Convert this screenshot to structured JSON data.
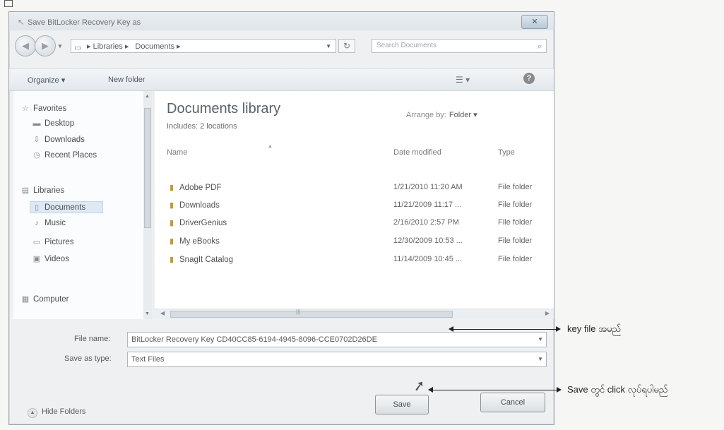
{
  "window": {
    "title": "Save BitLocker Recovery Key as",
    "close_label": "✕"
  },
  "address": {
    "back": "◀",
    "forward": "▶",
    "crumbs": [
      "▸ Libraries ▸",
      "Documents ▸"
    ],
    "search_placeholder": "Search Documents"
  },
  "toolbar": {
    "organize": "Organize ▾",
    "new_folder": "New folder",
    "views": "☰ ▾",
    "help": "?"
  },
  "sidebar": {
    "items": [
      {
        "label": "Favorites",
        "icon": "star-icon"
      },
      {
        "label": "Desktop",
        "icon": "desktop-icon"
      },
      {
        "label": "Downloads",
        "icon": "downloads-icon"
      },
      {
        "label": "Recent Places",
        "icon": "recent-places-icon"
      },
      {
        "label": "Libraries",
        "icon": "libraries-icon"
      },
      {
        "label": "Documents",
        "icon": "documents-icon"
      },
      {
        "label": "Music",
        "icon": "music-icon"
      },
      {
        "label": "Pictures",
        "icon": "pictures-icon"
      },
      {
        "label": "Videos",
        "icon": "videos-icon"
      },
      {
        "label": "Computer",
        "icon": "computer-icon"
      }
    ]
  },
  "library": {
    "title": "Documents library",
    "includes": "Includes: 2 locations",
    "arrange_label": "Arrange by:",
    "arrange_value": "Folder ▾"
  },
  "columns": {
    "name": "Name",
    "date": "Date modified",
    "type": "Type"
  },
  "files": [
    {
      "name": "Adobe PDF",
      "date": "1/21/2010 11:20 AM",
      "type": "File folder"
    },
    {
      "name": "Downloads",
      "date": "11/21/2009 11:17 ...",
      "type": "File folder"
    },
    {
      "name": "DriverGenius",
      "date": "2/16/2010 2:57 PM",
      "type": "File folder"
    },
    {
      "name": "My eBooks",
      "date": "12/30/2009 10:53 ...",
      "type": "File folder"
    },
    {
      "name": "SnagIt Catalog",
      "date": "11/14/2009 10:45 ...",
      "type": "File folder"
    }
  ],
  "form": {
    "file_name_label": "File name:",
    "file_name_value": "BitLocker Recovery Key CD40CC85-6194-4945-8096-CCE0702D26DE",
    "save_type_label": "Save as type:",
    "save_type_value": "Text Files"
  },
  "buttons": {
    "hide_folders": "Hide Folders",
    "save": "Save",
    "cancel": "Cancel"
  },
  "annotations": {
    "file_name": "key file အမည်",
    "save": "Save တွင် click လုပ်ရပါမည်"
  }
}
